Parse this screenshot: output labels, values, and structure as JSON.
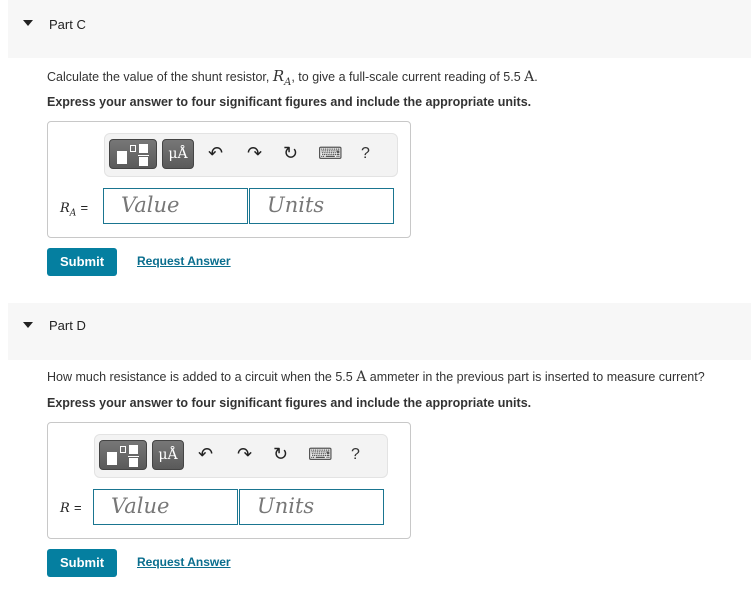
{
  "parts": [
    {
      "title": "Part C",
      "prompt_before": "Calculate the value of the shunt resistor, ",
      "prompt_var": "R",
      "prompt_var_sub": "A",
      "prompt_middle": ", to give a full-scale current reading of 5.5 ",
      "prompt_unit": "A",
      "prompt_after": ".",
      "instruction": "Express your answer to four significant figures and include the appropriate units.",
      "answer_label": "R",
      "answer_label_sub": "A",
      "equals": "=",
      "value_placeholder": "Value",
      "units_placeholder": "Units",
      "submit_label": "Submit",
      "request_label": "Request Answer"
    },
    {
      "title": "Part D",
      "prompt_before": "How much resistance is added to a circuit when the 5.5 ",
      "prompt_unit": "A",
      "prompt_after": " ammeter in the previous part is inserted to measure current?",
      "instruction": "Express your answer to four significant figures and include the appropriate units.",
      "answer_label": "R",
      "equals": "=",
      "value_placeholder": "Value",
      "units_placeholder": "Units",
      "submit_label": "Submit",
      "request_label": "Request Answer"
    }
  ],
  "toolbar": {
    "templates_icon": "fraction-template-icon",
    "units_icon_label": "μÅ",
    "undo": "↶",
    "redo": "↷",
    "reset": "↻",
    "keyboard": "⌨",
    "help": "?"
  },
  "colors": {
    "accent": "#057fa0",
    "field_border": "#1a7590",
    "header_bg": "#f7f7f7"
  }
}
